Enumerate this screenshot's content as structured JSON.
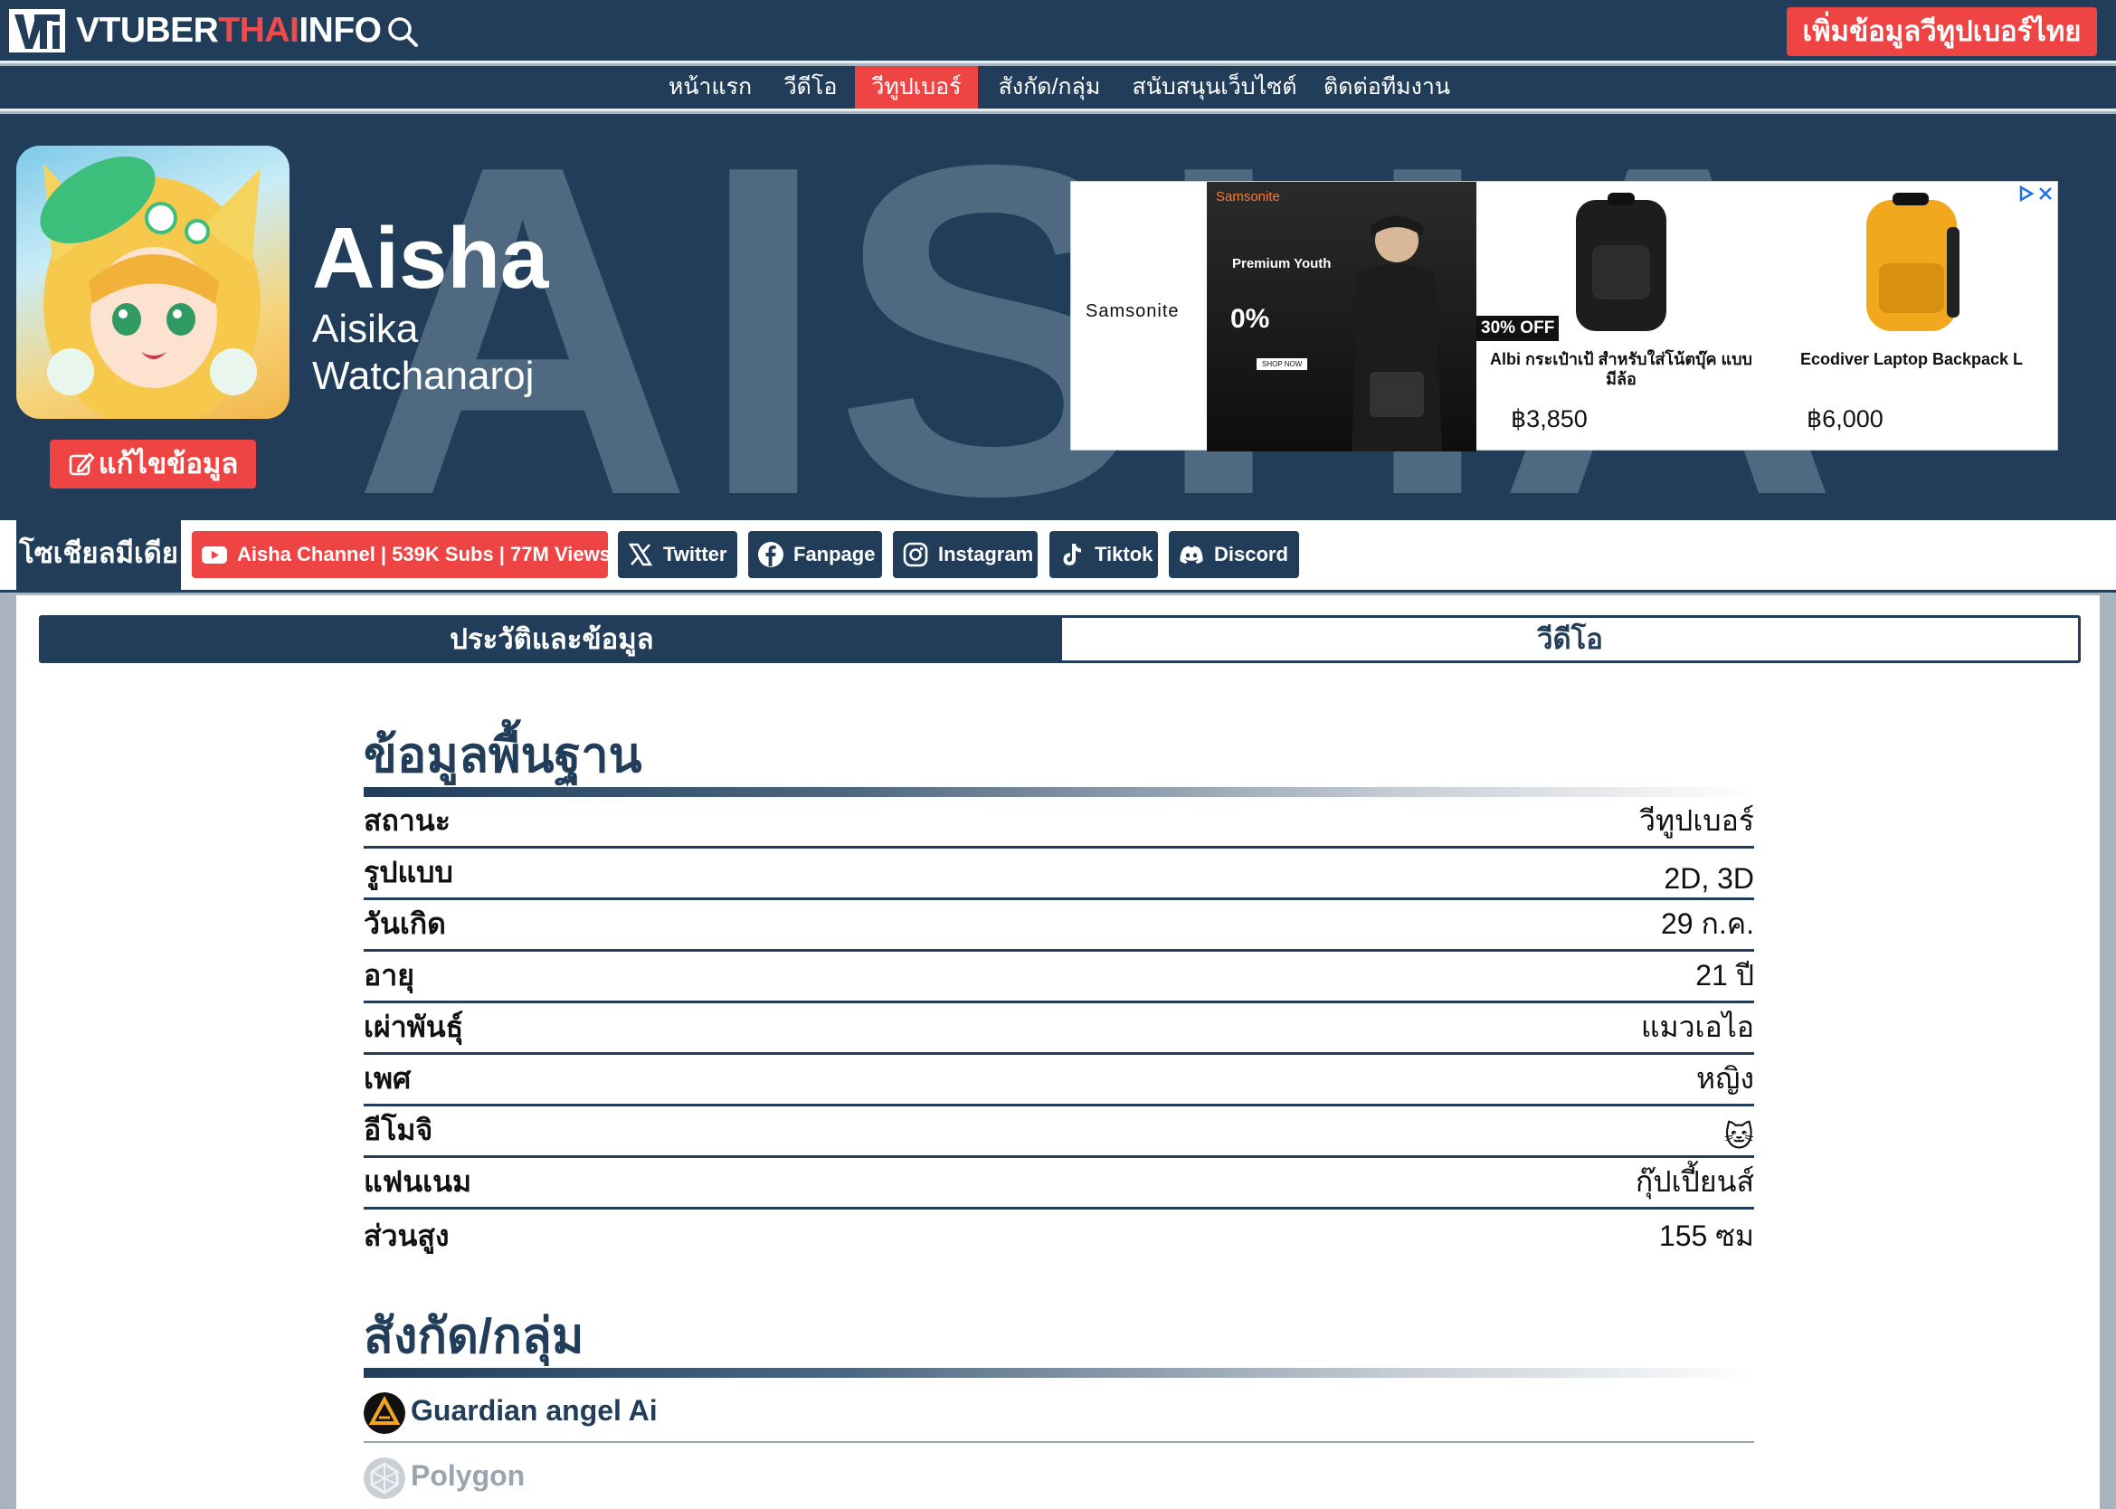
{
  "header": {
    "logo_vt": "VTi",
    "logo_part1": "VTUBER",
    "logo_part2": "THAI",
    "logo_part3": "INFO",
    "add_button": "เพิ่มข้อมูลวีทูปเบอร์ไทย"
  },
  "nav": {
    "items": [
      {
        "label": "หน้าแรก"
      },
      {
        "label": "วีดีโอ"
      },
      {
        "label": "วีทูปเบอร์",
        "active": true
      },
      {
        "label": "สังกัด/กลุ่ม"
      },
      {
        "label": "สนับสนุนเว็บไซต์"
      },
      {
        "label": "ติดต่อทีมงาน"
      }
    ]
  },
  "profile": {
    "background_text": "AISHA",
    "name": "Aisha",
    "full_name": "Aisika Watchanaroj",
    "edit_button": "แก้ไขข้อมูล"
  },
  "ad": {
    "brand": "Samsonite",
    "photo_brand": "Samsonite",
    "photo_tagline": "Premium Youth",
    "photo_installment": "0%",
    "photo_cta": "SHOP NOW",
    "badge": "30% OFF",
    "products": [
      {
        "name": "Albi กระเป๋าเป้ สำหรับใส่โน้ตบุ๊ค แบบมีล้อ",
        "price": "฿3,850"
      },
      {
        "name": "Ecodiver Laptop Backpack L",
        "price": "฿6,000"
      }
    ]
  },
  "social": {
    "label": "โซเชียลมีเดีย",
    "links": [
      {
        "label": "Aisha Channel | 539K Subs | 77M Views",
        "icon": "youtube-icon"
      },
      {
        "label": "Twitter",
        "icon": "x-twitter-icon"
      },
      {
        "label": "Fanpage",
        "icon": "facebook-icon"
      },
      {
        "label": "Instagram",
        "icon": "instagram-icon"
      },
      {
        "label": "Tiktok",
        "icon": "tiktok-icon"
      },
      {
        "label": "Discord",
        "icon": "discord-icon"
      }
    ]
  },
  "tabs": {
    "info": "ประวัติและข้อมูล",
    "videos": "วีดีโอ"
  },
  "basic_info": {
    "title": "ข้อมูลพื้นฐาน",
    "rows": [
      {
        "key": "สถานะ",
        "value": "วีทูปเบอร์"
      },
      {
        "key": "รูปแบบ",
        "value": "2D, 3D"
      },
      {
        "key": "วันเกิด",
        "value": "29 ก.ค."
      },
      {
        "key": "อายุ",
        "value": "21 ปี"
      },
      {
        "key": "เผ่าพันธุ์",
        "value": "แมวเอไอ"
      },
      {
        "key": "เพศ",
        "value": "หญิง"
      },
      {
        "key": "อีโมจิ",
        "value": "🐱"
      },
      {
        "key": "แฟนเนม",
        "value": "กุ๊ปเปี้ยนส์"
      },
      {
        "key": "ส่วนสูง",
        "value": "155 ซม"
      }
    ]
  },
  "affiliation": {
    "title": "สังกัด/กลุ่ม",
    "groups": [
      {
        "name": "Guardian angel Ai"
      },
      {
        "name": "Polygon"
      }
    ]
  },
  "colors": {
    "navy": "#213d59",
    "accent_red": "#ef4444"
  }
}
